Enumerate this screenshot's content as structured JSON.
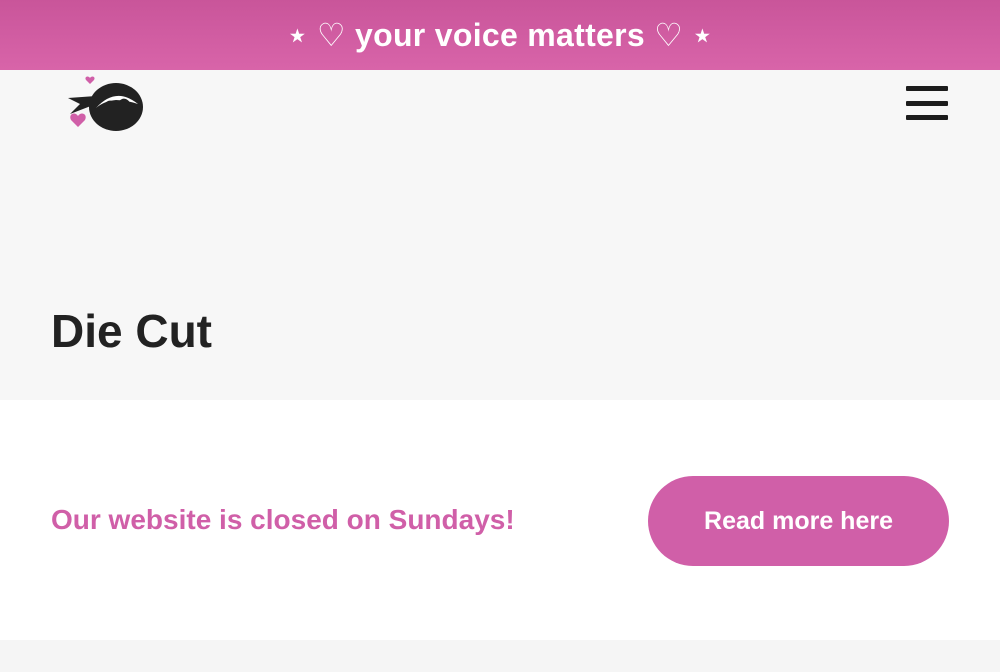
{
  "banner": {
    "text": "⋆ ♡ your voice matters ♡ ⋆",
    "color": "#d05fa8"
  },
  "header": {
    "logo_icon": "ninja-logo-icon",
    "menu_icon": "hamburger-menu-icon"
  },
  "page": {
    "title": "Die Cut"
  },
  "notice": {
    "message": "Our website is closed on Sundays!",
    "button_label": "Read more here"
  },
  "colors": {
    "accent": "#d05fa8",
    "text_dark": "#222222",
    "header_bg": "#f7f7f7"
  }
}
